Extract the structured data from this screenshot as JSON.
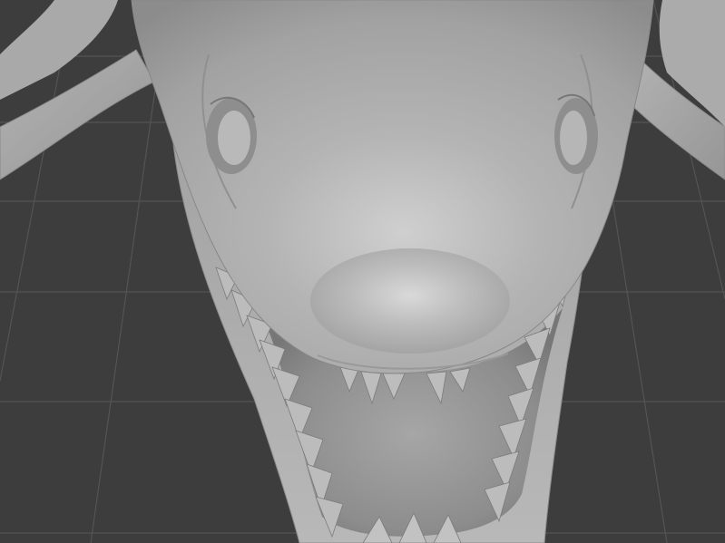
{
  "viewport": {
    "background_color": "#3d3d3d",
    "grid_color": "#545454",
    "model_base_color": "#a9a9a9",
    "model_highlight_color": "#d2d2d2",
    "model_shadow_color": "#6f6f6f",
    "shading_mode": "solid",
    "object": "shark-head-sculpt"
  }
}
